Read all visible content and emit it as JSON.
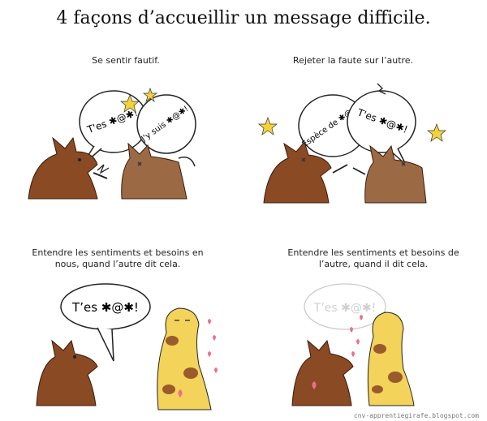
{
  "title": "4 façons d’accueillir un message difficile.",
  "panels": [
    {
      "caption": "Se sentir fautif.",
      "bubbles": [
        "T'es ✱@✱!",
        "J'y suis ✱@✱!"
      ]
    },
    {
      "caption": "Rejeter la faute sur l’autre.",
      "bubbles": [
        "Espèce de ✱@✱!",
        "T'es ✱@✱!"
      ]
    },
    {
      "caption": "Entendre les sentiments et besoins en nous, quand l’autre dit cela.",
      "bubbles": [
        "T’es ✱@✱!"
      ]
    },
    {
      "caption": "Entendre les sentiments et besoins de l’autre, quand il dit cela.",
      "bubbles": [
        "T’es ✱@✱!"
      ]
    }
  ],
  "footer": "cnv-apprentiegirafe.blogspot.com",
  "colors": {
    "wolf": "#8a4a24",
    "wolf_dark": "#5e2f14",
    "giraffe": "#f3d35a",
    "spot": "#9a5b2c",
    "heart": "#ee6f8a",
    "star": "#f5d23a"
  }
}
